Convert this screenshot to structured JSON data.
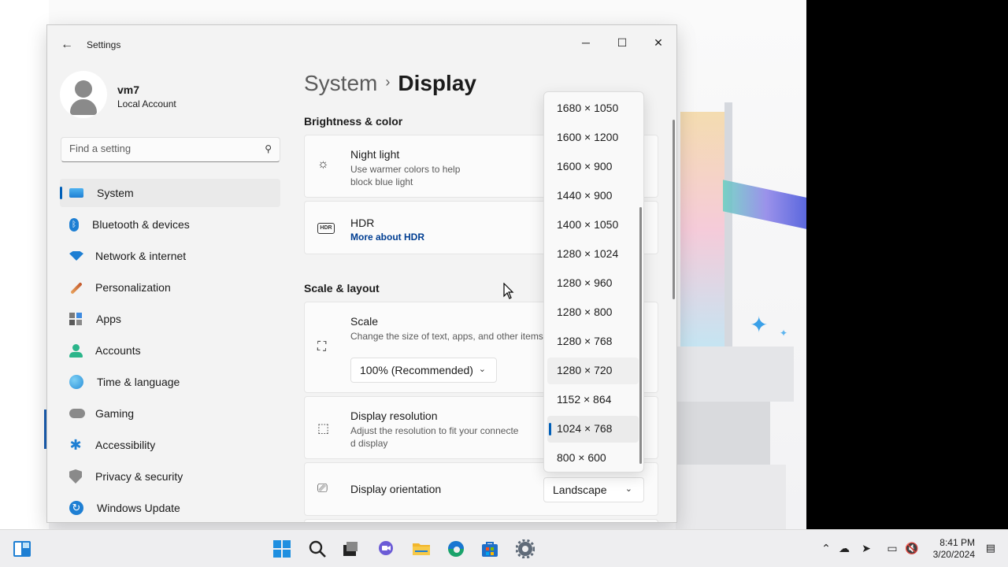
{
  "window": {
    "app_title": "Settings",
    "minimize_glyph": "─",
    "maximize_glyph": "☐",
    "close_glyph": "✕",
    "back_glyph": "←"
  },
  "profile": {
    "name": "vm7",
    "account_type": "Local Account"
  },
  "search": {
    "placeholder": "Find a setting",
    "icon": "search-icon"
  },
  "sidebar": {
    "items": [
      {
        "label": "System",
        "icon": "system-icon",
        "active": true
      },
      {
        "label": "Bluetooth & devices",
        "icon": "bluetooth-icon"
      },
      {
        "label": "Network & internet",
        "icon": "wifi-icon"
      },
      {
        "label": "Personalization",
        "icon": "brush-icon"
      },
      {
        "label": "Apps",
        "icon": "apps-icon"
      },
      {
        "label": "Accounts",
        "icon": "person-icon"
      },
      {
        "label": "Time & language",
        "icon": "globe-clock-icon"
      },
      {
        "label": "Gaming",
        "icon": "gamepad-icon"
      },
      {
        "label": "Accessibility",
        "icon": "accessibility-icon"
      },
      {
        "label": "Privacy & security",
        "icon": "shield-icon"
      },
      {
        "label": "Windows Update",
        "icon": "update-icon"
      }
    ]
  },
  "breadcrumb": {
    "parent": "System",
    "separator": "›",
    "current": "Display"
  },
  "sections": {
    "brightness": "Brightness & color",
    "scale_layout": "Scale & layout"
  },
  "night_light": {
    "title": "Night light",
    "desc_line1": "Use warmer colors to help",
    "desc_line2": "block blue light"
  },
  "hdr": {
    "badge": "HDR",
    "title": "HDR",
    "link": "More about HDR"
  },
  "scale": {
    "title": "Scale",
    "desc": "Change the size of text, apps, and other items",
    "value": "100% (Recommended)"
  },
  "resolution": {
    "title": "Display resolution",
    "desc_line1": "Adjust the resolution to fit your connecte",
    "desc_line2": "d display",
    "options": [
      "1680 × 1050",
      "1600 × 1200",
      "1600 × 900",
      "1440 × 900",
      "1400 × 1050",
      "1280 × 1024",
      "1280 × 960",
      "1280 × 800",
      "1280 × 768",
      "1280 × 720",
      "1152 × 864",
      "1024 × 768",
      "800 × 600"
    ],
    "selected": "1024 × 768",
    "hovered": "1280 × 720"
  },
  "orientation": {
    "title": "Display orientation",
    "value": "Landscape"
  },
  "taskbar": {
    "time": "8:41 PM",
    "date": "3/20/2024"
  }
}
